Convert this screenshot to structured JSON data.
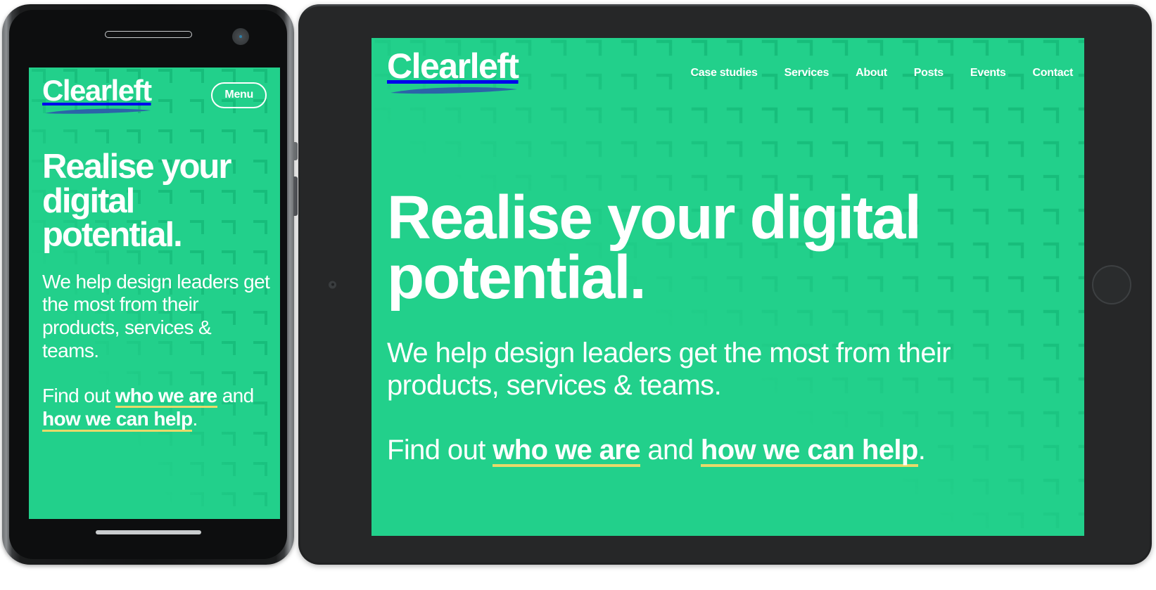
{
  "brand": {
    "name": "Clearleft",
    "logo_underline_color": "#2b64a8",
    "background_color": "#22d08b",
    "text_color": "#ffffff",
    "link_underline_color": "#e8d96a"
  },
  "phone": {
    "menu_label": "Menu",
    "heading": "Realise your digital potential.",
    "paragraph": "We help design leaders get the most from their products, services & teams.",
    "cta": {
      "prefix": "Find out ",
      "link1": "who we are",
      "middle": " and ",
      "link2": "how we can help",
      "suffix": "."
    }
  },
  "tablet": {
    "nav": [
      {
        "label": "Case studies"
      },
      {
        "label": "Services"
      },
      {
        "label": "About"
      },
      {
        "label": "Posts"
      },
      {
        "label": "Events"
      },
      {
        "label": "Contact"
      }
    ],
    "heading": "Realise your digital potential.",
    "paragraph": "We help design leaders get the most from their products, services & teams.",
    "cta": {
      "prefix": "Find out ",
      "link1": "who we are",
      "middle": " and ",
      "link2": "how we can help",
      "suffix": "."
    }
  }
}
